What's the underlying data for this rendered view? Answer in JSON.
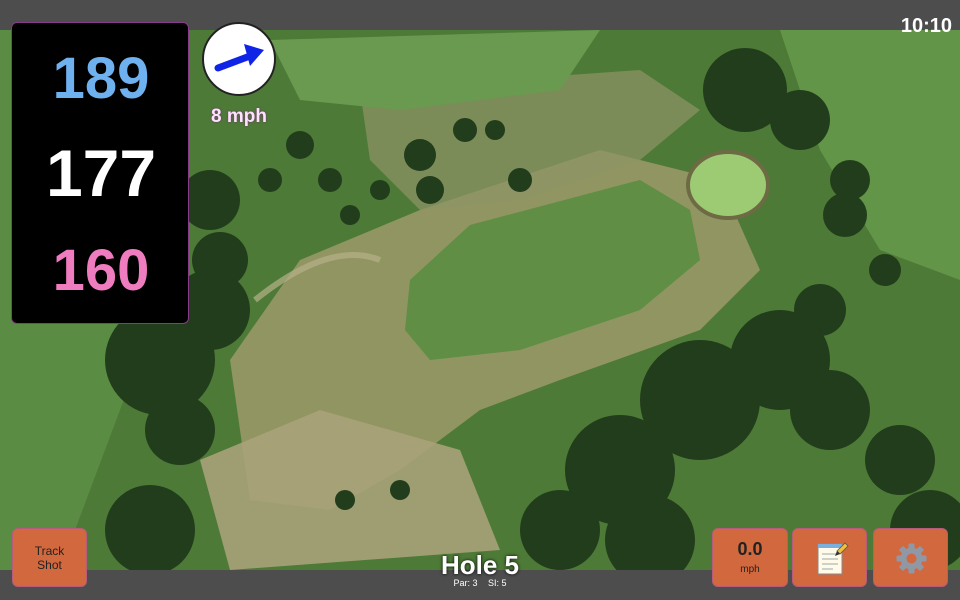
{
  "clock": {
    "time": "10:10"
  },
  "distances": {
    "back": "189",
    "middle": "177",
    "front": "160"
  },
  "wind": {
    "speed": "8 mph",
    "icon": "wind-direction-arrow-icon",
    "arrow_color": "#1024e8"
  },
  "hole": {
    "title": "Hole 5",
    "par": "Par: 3",
    "stroke_index": "SI: 5"
  },
  "buttons": {
    "track_shot_line1": "Track",
    "track_shot_line2": "Shot",
    "speed_value": "0.0",
    "speed_unit": "mph",
    "notes_icon": "notepad-icon",
    "settings_icon": "gear-icon"
  },
  "colors": {
    "back_distance": "#6fb1ef",
    "middle_distance": "#ffffff",
    "front_distance": "#f07cc0",
    "button": "#d2683d"
  }
}
